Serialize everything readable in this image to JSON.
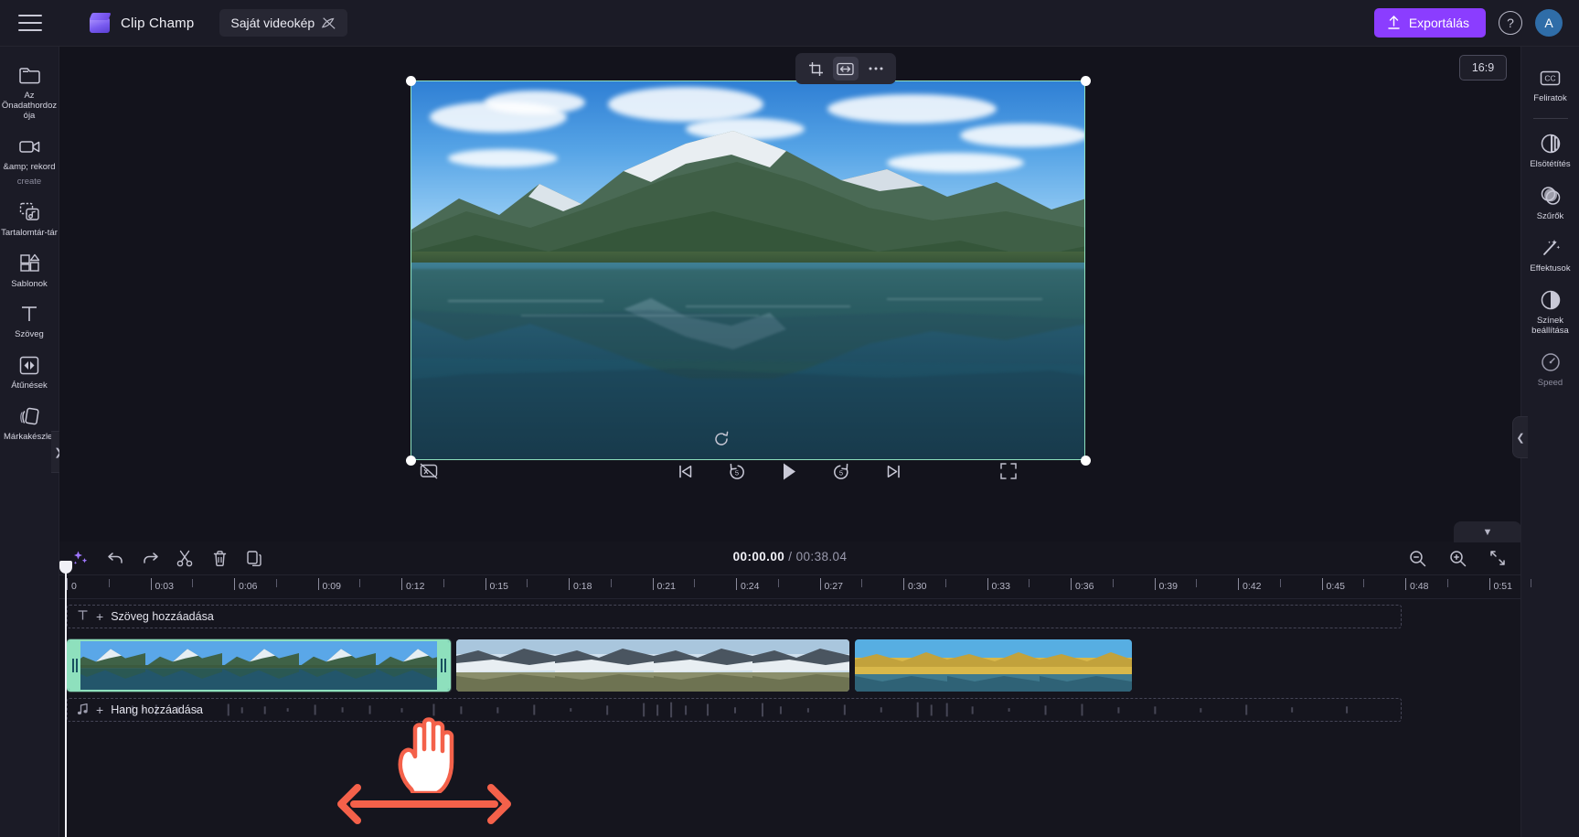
{
  "topbar": {
    "menu_icon": "hamburger-icon",
    "brand": "Clip Champ",
    "project_title": "Saját videokép",
    "visibility_icon": "eye-off-icon",
    "export_label": "Exportálás",
    "export_icon": "upload-icon",
    "help_label": "?",
    "avatar_initial": "A",
    "accent_color": "#8b3dff"
  },
  "left_rail": {
    "items": [
      {
        "label": "Az Önadathordozója",
        "icon": "folder-icon",
        "dim": false
      },
      {
        "label": "&amp; rekord",
        "sublabel": "create",
        "icon": "camera-video-icon",
        "dim": false
      },
      {
        "label": "Tartalomtár-tár",
        "icon": "content-library-icon",
        "dim": false
      },
      {
        "label": "Sablonok",
        "icon": "templates-icon",
        "dim": false
      },
      {
        "label": "Szöveg",
        "icon": "text-icon",
        "dim": false
      },
      {
        "label": "Átűnések",
        "icon": "transitions-icon",
        "dim": false
      },
      {
        "label": "Márkakészlet",
        "icon": "brand-kit-icon",
        "dim": false
      }
    ],
    "collapse_icon": "chevron-right-icon"
  },
  "right_rail": {
    "items": [
      {
        "label": "Feliratok",
        "icon": "captions-cc-icon",
        "dim": false
      },
      {
        "label": "Elsötétítés",
        "icon": "fade-icon",
        "dim": false
      },
      {
        "label": "Szűrők",
        "icon": "filters-icon",
        "dim": false
      },
      {
        "label": "Effektusok",
        "icon": "effects-wand-icon",
        "dim": false
      },
      {
        "label": "Színek beállítása",
        "icon": "adjust-colors-icon",
        "dim": false
      },
      {
        "label": "Speed",
        "icon": "speed-gauge-icon",
        "dim": true
      }
    ],
    "collapse_icon": "chevron-left-icon"
  },
  "stage": {
    "float_tools": [
      {
        "name": "crop-icon",
        "active": false
      },
      {
        "name": "fit-resize-icon",
        "active": true
      },
      {
        "name": "more-options-icon",
        "active": false
      }
    ],
    "aspect_ratio": "16:9",
    "selection_color": "#8ee0bd",
    "reset_icon": "reset-rotate-icon",
    "controls": {
      "captions_toggle_icon": "captions-off-icon",
      "skip_start_icon": "skip-to-start-icon",
      "rewind_icon": "rewind-5s-icon",
      "play_icon": "play-icon",
      "forward_icon": "forward-5s-icon",
      "skip_end_icon": "skip-to-end-icon",
      "fullscreen_icon": "fullscreen-icon"
    }
  },
  "timeline": {
    "toolbar_left": [
      {
        "name": "magic-sparkle-icon",
        "accent": true
      },
      {
        "name": "undo-icon",
        "accent": false
      },
      {
        "name": "redo-icon",
        "accent": false
      },
      {
        "name": "split-scissors-icon",
        "accent": false
      },
      {
        "name": "delete-trash-icon",
        "accent": false
      },
      {
        "name": "duplicate-icon",
        "accent": false
      }
    ],
    "current_time": "00:00.00",
    "separator": "/",
    "total_time": "00:38.04",
    "toolbar_right": [
      {
        "name": "zoom-out-icon"
      },
      {
        "name": "zoom-in-icon"
      },
      {
        "name": "fit-timeline-icon"
      }
    ],
    "panel_caret_icon": "chevron-down-icon",
    "ruler_labels": [
      "0",
      "0:03",
      "0:06",
      "0:09",
      "0:12",
      "0:15",
      "0:18",
      "0:21",
      "0:24",
      "0:27",
      "0:30",
      "0:33",
      "0:36",
      "0:39",
      "0:42",
      "0:45",
      "0:48",
      "0:51"
    ],
    "text_track": {
      "icon": "text-T-icon",
      "plus": "+",
      "label": "Szöveg hozzáadása"
    },
    "audio_track": {
      "icon": "music-note-icon",
      "plus": "+",
      "label": "Hang hozzáadása"
    },
    "clips": [
      {
        "name": "clip-fjord-selected",
        "selected": true,
        "scene": "fjord"
      },
      {
        "name": "clip-glacier",
        "selected": false,
        "scene": "glacier"
      },
      {
        "name": "clip-canyon",
        "selected": false,
        "scene": "canyon"
      }
    ]
  },
  "annotation": {
    "cursor_icon": "hand-pointer-cursor",
    "arrow_icon": "double-headed-horizontal-arrow",
    "arrow_color": "#f4614a"
  }
}
